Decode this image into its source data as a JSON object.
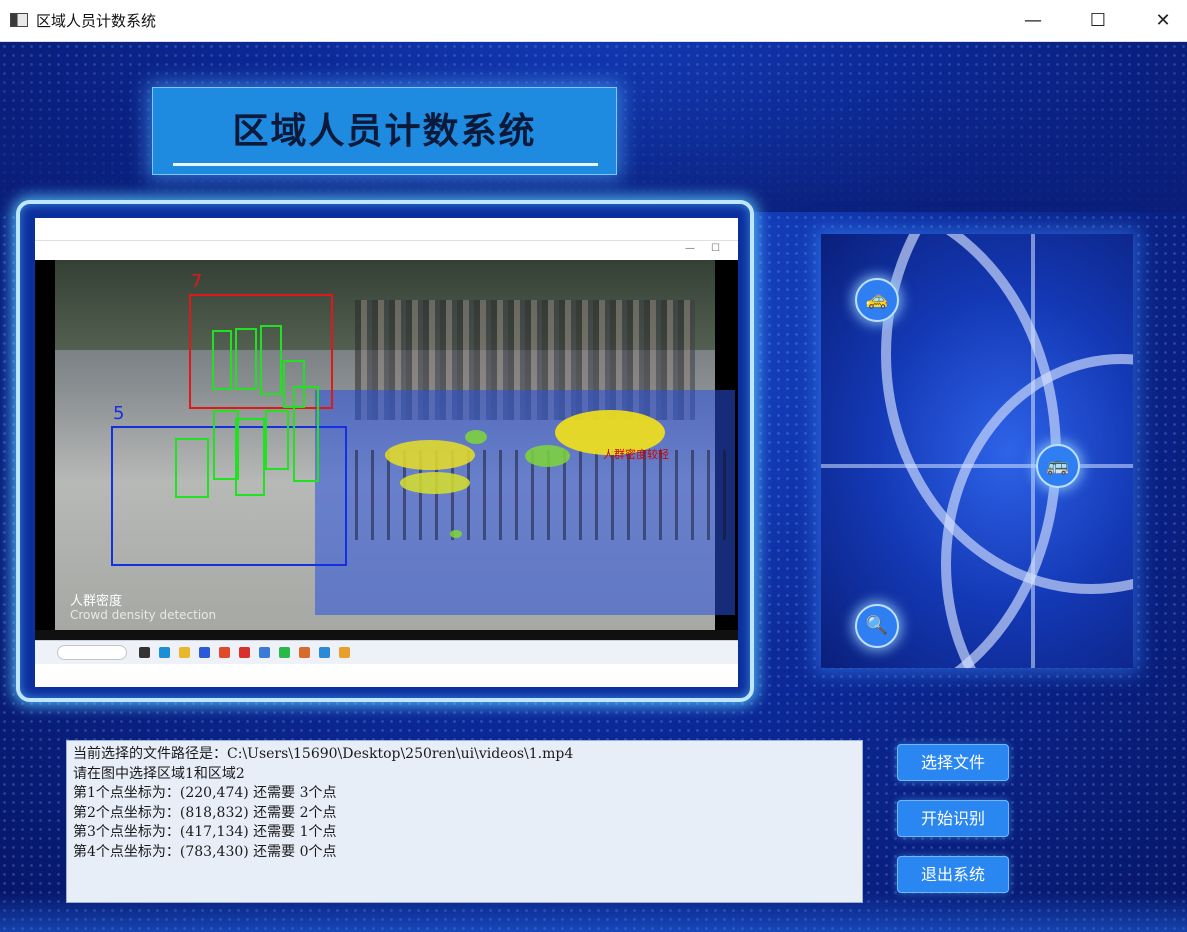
{
  "window": {
    "title": "区域人员计数系统",
    "minimize": "—",
    "maximize": "☐",
    "close": "✕"
  },
  "header": {
    "title": "区域人员计数系统"
  },
  "video": {
    "box_red_label": "7",
    "box_blue_label": "5",
    "caption_cn": "人群密度",
    "caption_en": "Crowd density detection",
    "density_text": "人群密度较轻"
  },
  "log": {
    "lines": [
      "当前选择的文件路径是：C:\\Users\\15690\\Desktop\\250ren\\ui\\videos\\1.mp4",
      "请在图中选择区域1和区域2",
      "第1个点坐标为：(220,474) 还需要 3个点",
      "第2个点坐标为：(818,832) 还需要 2个点",
      "第3个点坐标为：(417,134) 还需要 1个点",
      "第4个点坐标为：(783,430) 还需要 0个点"
    ]
  },
  "buttons": {
    "select_file": "选择文件",
    "start": "开始识别",
    "exit": "退出系统"
  },
  "icons": {
    "car": "car-icon",
    "bus": "bus-icon",
    "search": "search-icon"
  }
}
